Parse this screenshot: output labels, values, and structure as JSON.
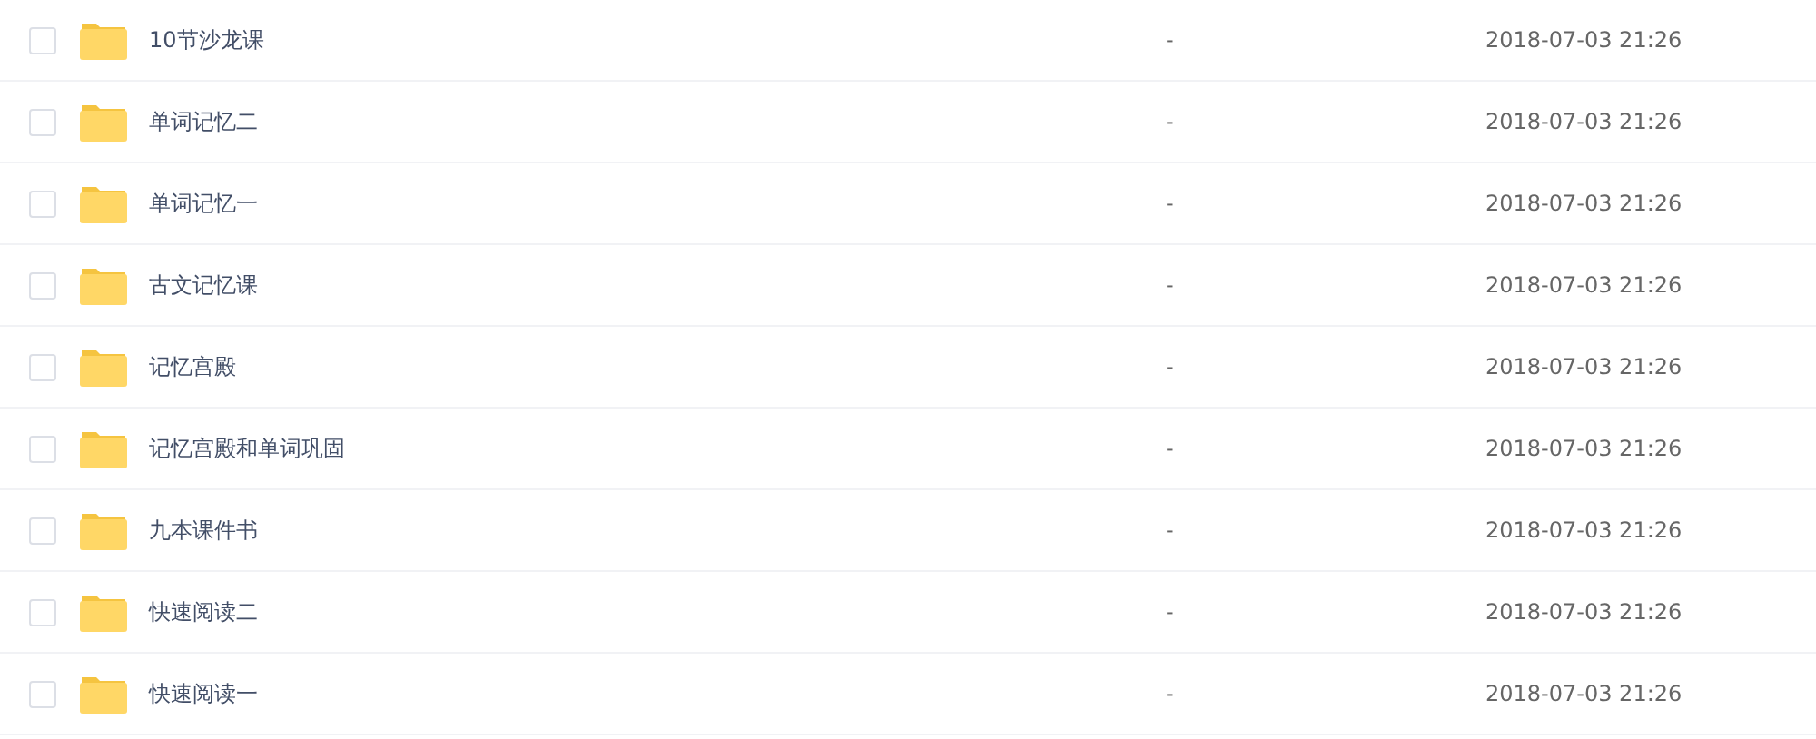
{
  "files": [
    {
      "name": "10节沙龙课",
      "size": "-",
      "modified": "2018-07-03 21:26",
      "checked": false
    },
    {
      "name": "单词记忆二",
      "size": "-",
      "modified": "2018-07-03 21:26",
      "checked": false
    },
    {
      "name": "单词记忆一",
      "size": "-",
      "modified": "2018-07-03 21:26",
      "checked": false
    },
    {
      "name": "古文记忆课",
      "size": "-",
      "modified": "2018-07-03 21:26",
      "checked": false
    },
    {
      "name": "记忆宫殿",
      "size": "-",
      "modified": "2018-07-03 21:26",
      "checked": false
    },
    {
      "name": "记忆宫殿和单词巩固",
      "size": "-",
      "modified": "2018-07-03 21:26",
      "checked": false
    },
    {
      "name": "九本课件书",
      "size": "-",
      "modified": "2018-07-03 21:26",
      "checked": false
    },
    {
      "name": "快速阅读二",
      "size": "-",
      "modified": "2018-07-03 21:26",
      "checked": false
    },
    {
      "name": "快速阅读一",
      "size": "-",
      "modified": "2018-07-03 21:26",
      "checked": false
    }
  ]
}
